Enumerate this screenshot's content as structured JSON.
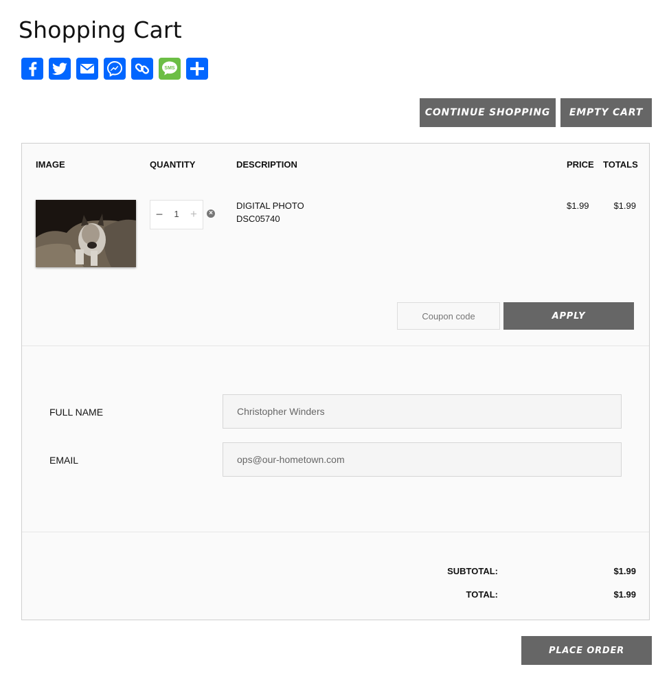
{
  "page": {
    "title": "Shopping Cart"
  },
  "share": {
    "icons": [
      {
        "name": "facebook-icon",
        "color": "#0166ff"
      },
      {
        "name": "twitter-icon",
        "color": "#0166ff"
      },
      {
        "name": "email-icon",
        "color": "#0166ff"
      },
      {
        "name": "messenger-icon",
        "color": "#0166ff"
      },
      {
        "name": "copy-link-icon",
        "color": "#0166ff"
      },
      {
        "name": "sms-icon",
        "color": "#6cbe45",
        "text": "SMS"
      },
      {
        "name": "share-plus-icon",
        "color": "#0166ff"
      }
    ]
  },
  "actions": {
    "continue_shopping": "CONTINUE SHOPPING",
    "empty_cart": "EMPTY CART",
    "apply": "APPLY",
    "place_order": "PLACE ORDER",
    "button_color": "#666666"
  },
  "cart": {
    "headers": {
      "image": "IMAGE",
      "quantity": "QUANTITY",
      "description": "DESCRIPTION",
      "price": "PRICE",
      "totals": "TOTALS"
    },
    "items": [
      {
        "name": "DIGITAL PHOTO",
        "sku": "DSC05740",
        "quantity": "1",
        "price": "$1.99",
        "total": "$1.99"
      }
    ],
    "qty_minus": "−",
    "qty_plus": "+",
    "remove": "×"
  },
  "coupon": {
    "placeholder": "Coupon code"
  },
  "form": {
    "full_name_label": "FULL NAME",
    "full_name_value": "Christopher Winders",
    "email_label": "EMAIL",
    "email_value": "ops@our-hometown.com"
  },
  "summary": {
    "subtotal_label": "SUBTOTAL:",
    "subtotal_value": "$1.99",
    "total_label": "TOTAL:",
    "total_value": "$1.99"
  }
}
